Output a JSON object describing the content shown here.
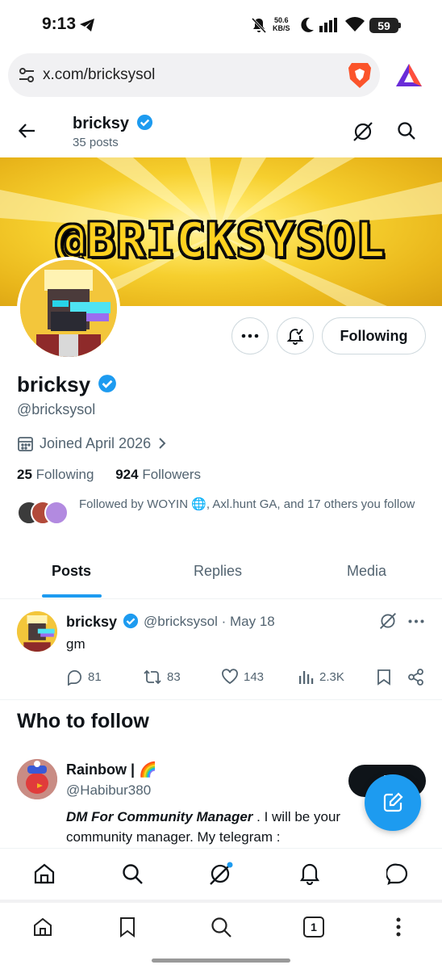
{
  "status_bar": {
    "time": "9:13",
    "net_speed_value": "50.6",
    "net_speed_unit": "KB/S",
    "battery": "59"
  },
  "browser": {
    "url": "x.com/bricksysol",
    "tab_count": "1",
    "icons": [
      "site-settings-icon",
      "brave-shield-icon",
      "brave-rewards-icon",
      "home-icon",
      "bookmark-icon",
      "search-icon",
      "tabs-icon",
      "menu-icon"
    ]
  },
  "header": {
    "name": "bricksy",
    "posts_count": "35 posts"
  },
  "banner": {
    "text": "@BRICKSYSOL"
  },
  "profile": {
    "display_name": "bricksy",
    "handle": "@bricksysol",
    "joined": "Joined April 2026",
    "following_count": "25",
    "following_label": "Following",
    "followers_count": "924",
    "followers_label": "Followers",
    "followed_by": "Followed by WOYIN 🌐, Axl.hunt GA, and 17 others you follow",
    "following_button": "Following"
  },
  "tabs": [
    "Posts",
    "Replies",
    "Media"
  ],
  "tweet": {
    "name": "bricksy",
    "handle_date": "@bricksysol · May 18",
    "text": "gm",
    "replies": "81",
    "reposts": "83",
    "likes": "143",
    "views": "2.3K"
  },
  "who_to_follow": {
    "title": "Who to follow",
    "name": "Rainbow | 🌈",
    "handle": "@Habibur380",
    "bio_bold": "DM For Community Manager",
    "bio_rest": " . I will be your community manager. My telegram :",
    "follow_button": "F"
  },
  "colors": {
    "accent": "#1d9bf0",
    "text": "#0f1419",
    "muted": "#536471"
  }
}
